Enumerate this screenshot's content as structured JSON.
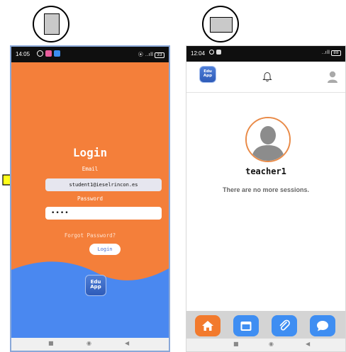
{
  "left_phone": {
    "status_time": "14:05",
    "status_right": "⦿ ..ıll",
    "battery": "33",
    "title": "Login",
    "email_label": "Email",
    "email_value": "student1@ieselrincon.es",
    "password_label": "Password",
    "password_value": "••••",
    "forgot_password": "Forgot Password?",
    "login_button": "Login",
    "logo_line1": "Edu",
    "logo_line2": "App",
    "colors": {
      "background": "#f47f3a",
      "wave": "#4a88f0"
    }
  },
  "right_phone": {
    "status_time": "12:04",
    "status_right": "..ıll",
    "battery": "88",
    "logo_line1": "Edu",
    "logo_line2": "App",
    "username": "teacher1",
    "no_sessions_text": "There are no more sessions.",
    "bottom_tabs": [
      {
        "icon": "home-icon",
        "color": "#f27a2d"
      },
      {
        "icon": "calendar-icon",
        "color": "#3f8ef2"
      },
      {
        "icon": "paperclip-icon",
        "color": "#3f8ef2"
      },
      {
        "icon": "chat-icon",
        "color": "#3f8ef2"
      }
    ]
  },
  "nav_bar": {
    "recent": "■",
    "home": "◉",
    "back": "◀"
  }
}
